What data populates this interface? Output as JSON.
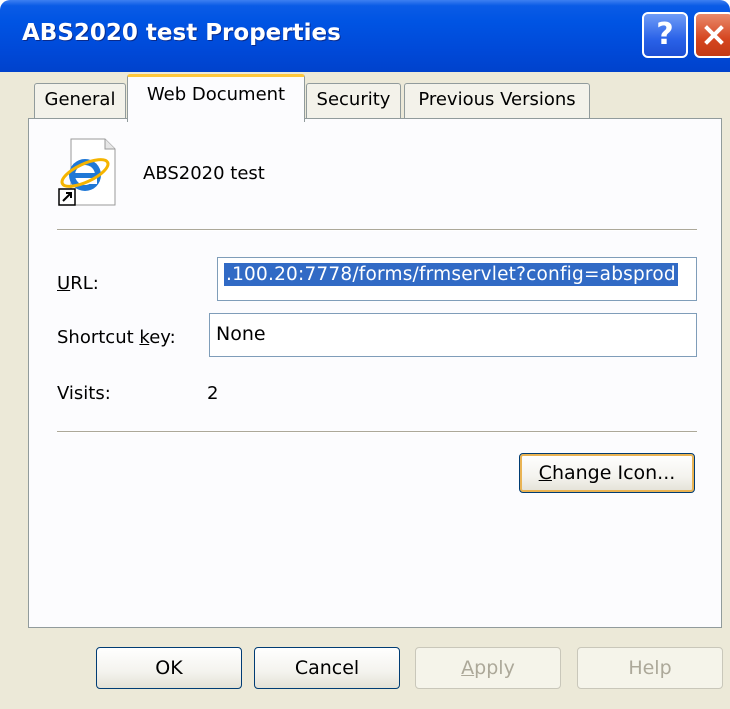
{
  "window": {
    "title": "ABS2020 test Properties",
    "help_glyph": "?"
  },
  "tabs": [
    {
      "label": "General"
    },
    {
      "label": "Web Document"
    },
    {
      "label": "Security"
    },
    {
      "label": "Previous Versions"
    }
  ],
  "shortcut": {
    "name": "ABS2020 test",
    "icon": "internet-explorer-shortcut-icon"
  },
  "fields": {
    "url_label": "URL:",
    "url_value": ".100.20:7778/forms/frmservlet?config=absprod",
    "shortcut_key_label": "Shortcut key:",
    "shortcut_key_value": "None",
    "visits_label": "Visits:",
    "visits_value": "2"
  },
  "buttons": {
    "change_icon": "Change Icon...",
    "ok": "OK",
    "cancel": "Cancel",
    "apply": "Apply",
    "help": "Help"
  },
  "colors": {
    "title_bar": "#0054e3",
    "selection": "#316ac5",
    "dialog_bg": "#ece9d8",
    "tab_highlight": "#ffc83c"
  }
}
